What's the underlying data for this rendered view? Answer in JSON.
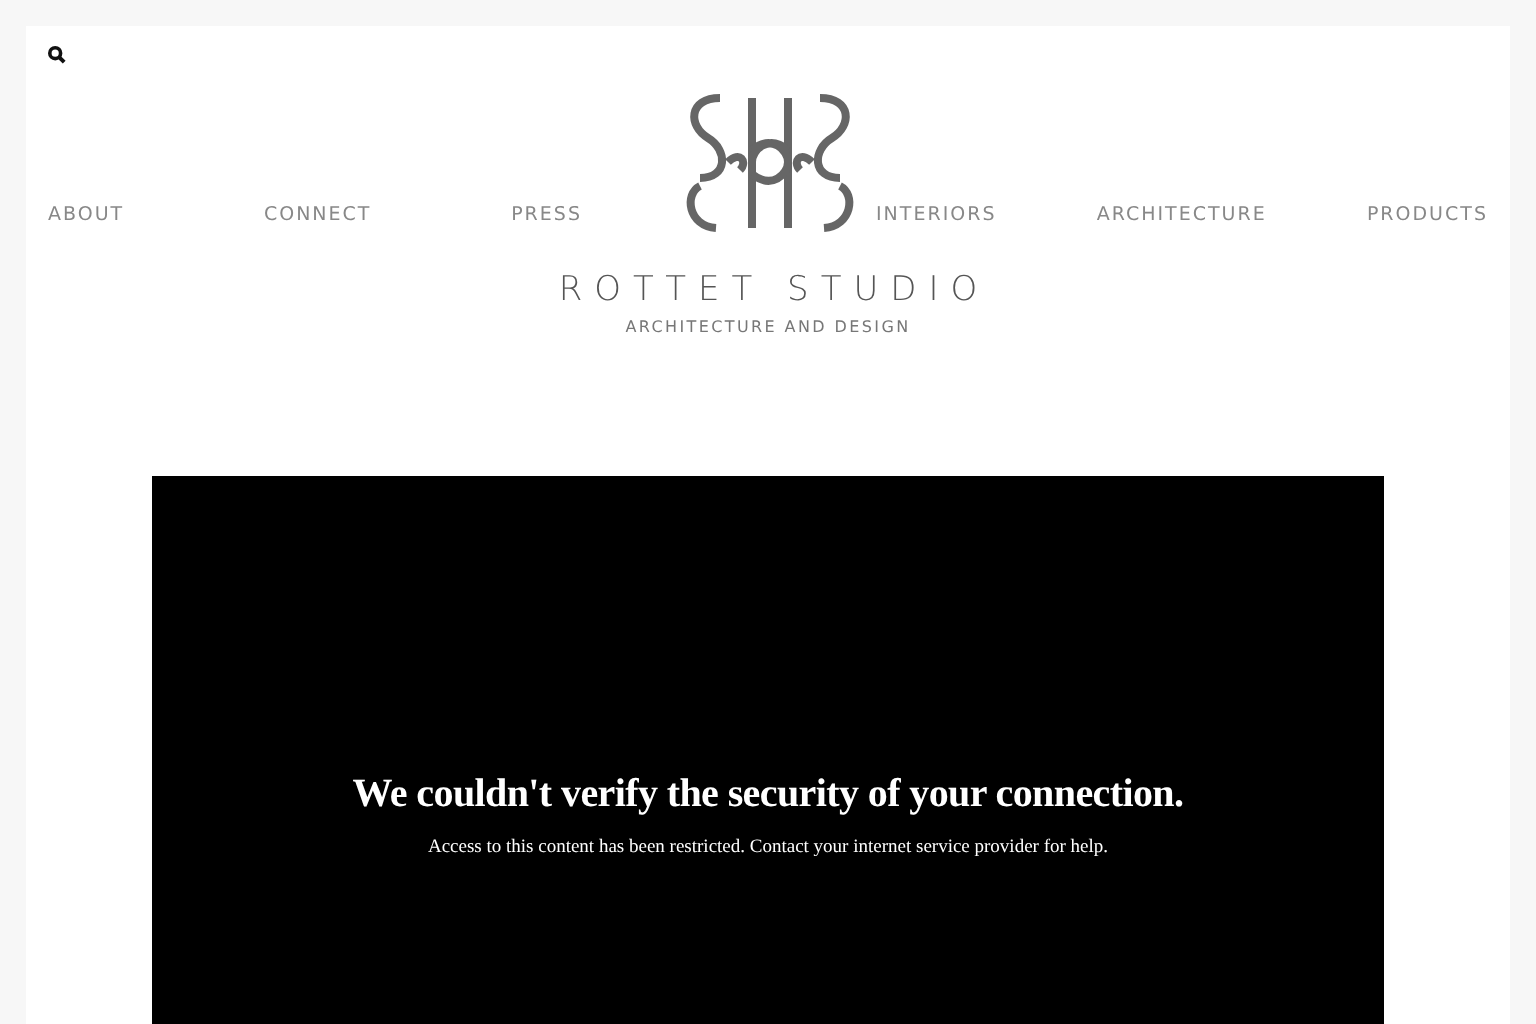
{
  "nav_left": [
    "ABOUT",
    "CONNECT",
    "PRESS"
  ],
  "nav_right": [
    "INTERIORS",
    "ARCHITECTURE",
    "PRODUCTS"
  ],
  "brand": {
    "name": "ROTTET STUDIO",
    "tagline": "ARCHITECTURE AND DESIGN"
  },
  "notice": {
    "title": "We couldn't verify the security of your connection.",
    "message": "Access to this content has been restricted. Contact your internet service provider for help."
  }
}
